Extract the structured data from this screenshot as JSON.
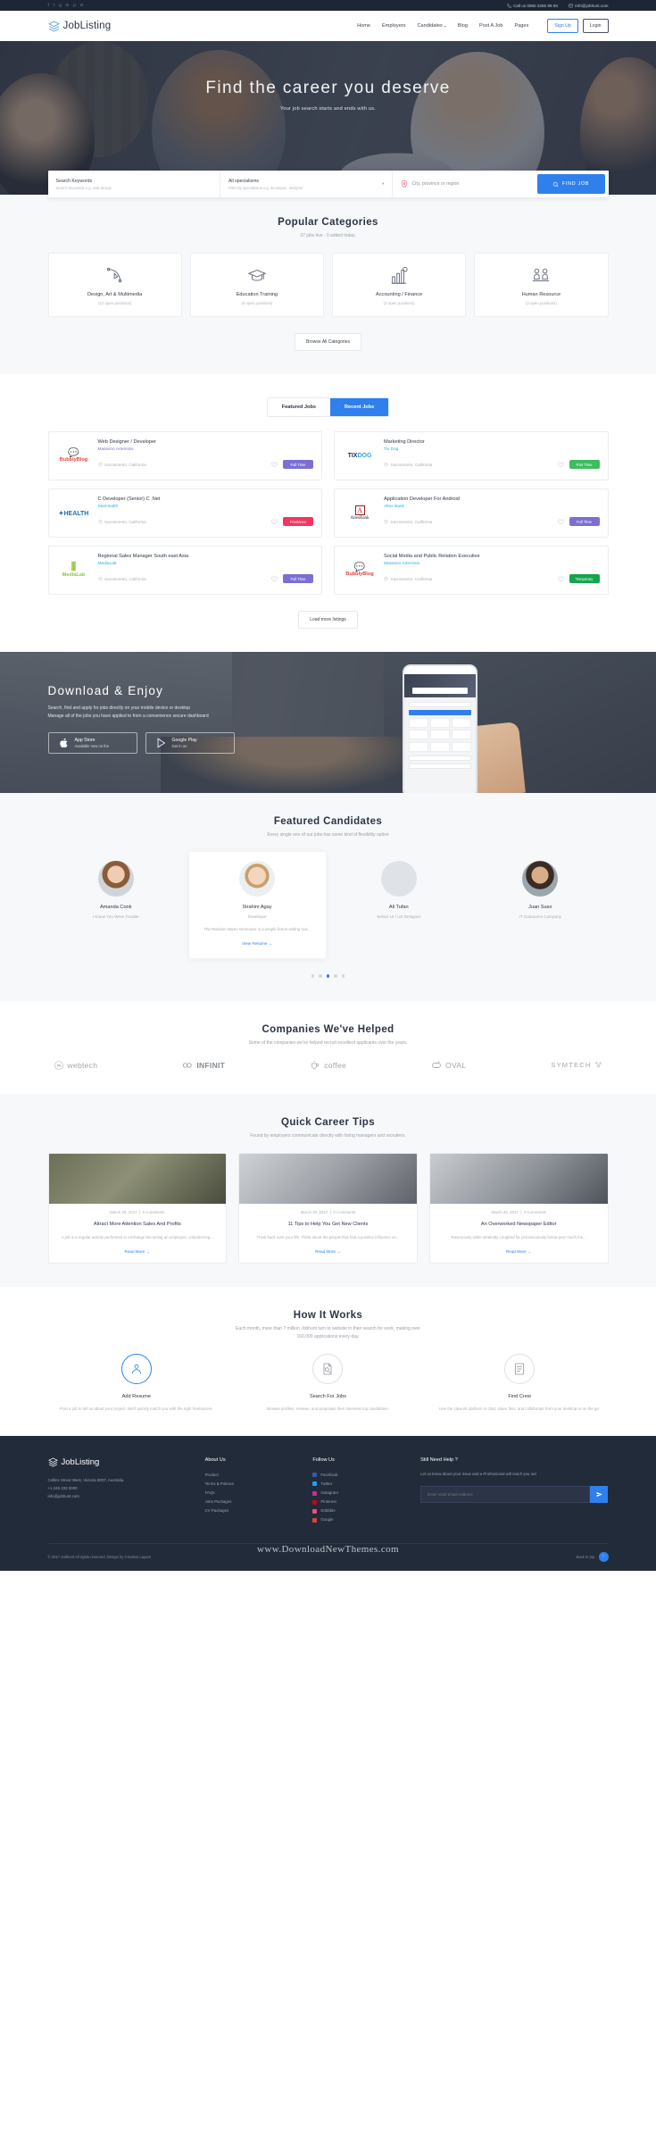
{
  "topbar": {
    "social": [
      "f",
      "t",
      "g",
      "in",
      "p",
      "G"
    ],
    "phone": "Call us 0850 3256 98 65",
    "email": "info@jobhunt.com"
  },
  "nav": {
    "brand": "JobListing",
    "links": [
      {
        "label": "Home",
        "caret": false
      },
      {
        "label": "Employers",
        "caret": false
      },
      {
        "label": "Candidates",
        "caret": true
      },
      {
        "label": "Blog",
        "caret": false
      },
      {
        "label": "Post A Job",
        "caret": false
      },
      {
        "label": "Pages",
        "caret": false
      }
    ],
    "signup": "Sign Up",
    "login": "Login"
  },
  "hero": {
    "title": "Find the career you deserve",
    "subtitle": "Your job search starts and ends with us."
  },
  "search": {
    "keywords_label": "Search Keywords",
    "keywords_placeholder": "Search keywords e.g. web design",
    "spec_label": "All specialisms",
    "spec_placeholder": "Filter by specialisms e.g. developer, designer",
    "location_placeholder": "City, province or region",
    "button": "FIND JOB"
  },
  "categories": {
    "title": "Popular Categories",
    "subtitle": "37 jobs live - 0 added today.",
    "items": [
      {
        "name": "Design, Art & Multimedia",
        "count": "(22 open positions)",
        "icon": "pen-tool-icon"
      },
      {
        "name": "Education Training",
        "count": "(6 open positions)",
        "icon": "graduation-cap-icon"
      },
      {
        "name": "Accounting / Finance",
        "count": "(3 open positions)",
        "icon": "bar-chart-icon"
      },
      {
        "name": "Human Resource",
        "count": "(3 open positions)",
        "icon": "people-desk-icon"
      }
    ],
    "browse_button": "Browse All Categories"
  },
  "jobs": {
    "tabs": [
      {
        "label": "Featured Jobs",
        "active": false
      },
      {
        "label": "Recent Jobs",
        "active": true
      }
    ],
    "items": [
      {
        "title": "Web Designer / Developer",
        "company": "Massimo Artemisis",
        "company_color": "#7b6fd4",
        "location": "Sacramento, California",
        "tag": "Full Time",
        "tag_color": "#7b6fd4",
        "logo": "bubblyblog"
      },
      {
        "title": "Marketing Director",
        "company": "Tix Dog",
        "company_color": "#29abe2",
        "location": "Sacramento, California",
        "tag": "Part Time",
        "tag_color": "#3ebd5f",
        "logo": "tixdog"
      },
      {
        "title": "C Developer (Senior) C .Net",
        "company": "StarHealth",
        "company_color": "#29abe2",
        "location": "Sacramento, California",
        "tag": "Freelance",
        "tag_color": "#f2365f",
        "logo": "starhealth"
      },
      {
        "title": "Application Developer For Android",
        "company": "Altes Bank",
        "company_color": "#29abe2",
        "location": "Sacramento, California",
        "tag": "Full Time",
        "tag_color": "#7b6fd4",
        "logo": "altesbank"
      },
      {
        "title": "Regional Sales Manager South east Asia",
        "company": "MediaLab",
        "company_color": "#29abe2",
        "location": "Sacramento, California",
        "tag": "Full Time",
        "tag_color": "#7b6fd4",
        "logo": "medialab"
      },
      {
        "title": "Social Media and Public Relation Executive",
        "company": "Massimo Artemisis",
        "company_color": "#29abe2",
        "location": "Sacramento, California",
        "tag": "Temporary",
        "tag_color": "#14a44d",
        "logo": "bubblyblog"
      }
    ],
    "load_more": "Load more listings"
  },
  "download": {
    "title": "Download & Enjoy",
    "line1": "Search, find and apply for jobs directly on your mobile device or desktop",
    "line2": "Manage all of the jobs you have applied to from a convenience secure dashboard",
    "stores": [
      {
        "name": "App Store",
        "sub": "Available now on the",
        "icon": "apple-icon"
      },
      {
        "name": "Google Play",
        "sub": "Get in on",
        "icon": "google-play-icon"
      }
    ]
  },
  "candidates": {
    "title": "Featured Candidates",
    "subtitle": "Every single one of our jobs has some kind of flexibility option",
    "items": [
      {
        "name": "Amanda Cook",
        "role": "I Knew You Were Trouble",
        "featured": false,
        "desc": "",
        "link": ""
      },
      {
        "name": "İbrahim Agay",
        "role": "Developer",
        "featured": true,
        "desc": "The Random Name Generator is a simple fiction writing tool...",
        "link": "View Resume"
      },
      {
        "name": "Ali Tufan",
        "role": "Senior UI / UX Designer",
        "featured": false,
        "desc": "",
        "link": ""
      },
      {
        "name": "Juan Suso",
        "role": "IT Outsource Company",
        "featured": false,
        "desc": "",
        "link": ""
      }
    ],
    "dots": 5,
    "active_dot": 2
  },
  "companies": {
    "title": "Companies We've Helped",
    "subtitle": "Some of the companies we've helped recruit excellent applicants over the years.",
    "items": [
      "webtech",
      "INFINIT",
      "coffee",
      "OVAL",
      "SYMTECH"
    ]
  },
  "blog": {
    "title": "Quick Career Tips",
    "subtitle": "Found by employers communicate directly with hiring managers and recruiters.",
    "posts": [
      {
        "date": "March 29, 2017",
        "comments": "0 Comments",
        "title": "Attract More Attention Sales And Profits",
        "excerpt": "A job is a regular activity performed in exchange becoming an employee, volunteering...",
        "more": "Read More"
      },
      {
        "date": "March 29, 2017",
        "comments": "0 Comments",
        "title": "11 Tips to Help You Get New Clients",
        "excerpt": "Think back over your life. Think about the people that had a positive influence on...",
        "more": "Read More"
      },
      {
        "date": "March 29, 2017",
        "comments": "0 Comments",
        "title": "An Overworked Newspaper Editor",
        "excerpt": "Ravenously while stridently coughed far promiscuously below jeez much ihe...",
        "more": "Read More"
      }
    ]
  },
  "how": {
    "title": "How It Works",
    "subtitle_1": "Each month, more than 7 million Jobhunt turn to website in their search for work, making over",
    "subtitle_2": "160,000 applications every day.",
    "items": [
      {
        "title": "Add Resume",
        "text": "Post a job to tell us about your project. We'll quickly match you with the right freelancers.",
        "icon": "user-resume-icon"
      },
      {
        "title": "Search For Jobs",
        "text": "Browse profiles, reviews, and proposals then interview top candidates.",
        "icon": "search-document-icon"
      },
      {
        "title": "Find Crew",
        "text": "Use the Upwork platform to chat, share files, and collaborate from your desktop or on the go.",
        "icon": "checklist-icon"
      }
    ]
  },
  "footer": {
    "brand": "JobListing",
    "address": "Collins Street West, Victoria 8007, Australia.",
    "phone": "+1 246 333 0000",
    "email": "info@jobhunt.com",
    "about_heading": "About Us",
    "about_links": [
      "Product",
      "Terms & Policies",
      "FAQs",
      "Jobs Packages",
      "CV Packages"
    ],
    "follow_heading": "Follow Us",
    "follow_links": [
      {
        "label": "Facebook",
        "color": "#3b5998"
      },
      {
        "label": "Twitter",
        "color": "#1da1f2"
      },
      {
        "label": "Instagram",
        "color": "#c13584"
      },
      {
        "label": "Pinterest",
        "color": "#bd081c"
      },
      {
        "label": "Dribbble",
        "color": "#ea4c89"
      },
      {
        "label": "Google",
        "color": "#db4437"
      }
    ],
    "help_heading": "Still Need Help ?",
    "help_text": "Let us know about your issue and a Professional will reach you out",
    "subscribe_placeholder": "Enter Valid Email Address",
    "copyright": "© 2017 Jobhunt All rights reserved. Design by Creative Layers",
    "back_to_top": "Back to top",
    "watermark": "www.DownloadNewThemes.com"
  }
}
